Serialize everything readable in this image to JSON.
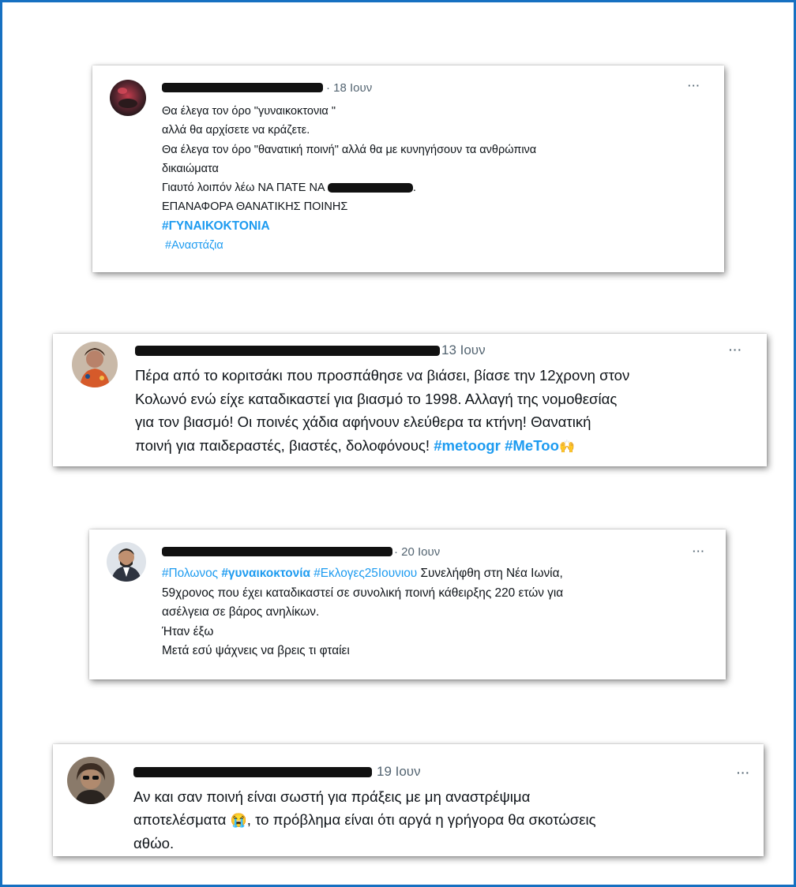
{
  "tweets": [
    {
      "time": "· 18 Ιουν",
      "more": "···",
      "lines": {
        "l1": "Θα έλεγα τον όρο \"γυναικοκτονια \"",
        "l2": "αλλά θα αρχίσετε να κράζετε.",
        "l3": "Θα έλεγα τον όρο \"θανατική ποινή\" αλλά θα με κυνηγήσουν τα ανθρώπινα",
        "l4": "δικαιώματα",
        "l5": "Γιαυτό λοιπόν λέω ΝΑ ΠΑΤΕ ΝΑ",
        "l5_end": ".",
        "l6": "ΕΠΑΝΑΦΟΡΑ ΘΑΝΑΤΙΚΗΣ ΠΟΙΝΗΣ",
        "tag1": "#ΓΥΝΑΙΚΟΚΤΟΝΙΑ",
        "tag2": "#Αναστάζια"
      }
    },
    {
      "time": "13 Ιουν",
      "more": "···",
      "lines": {
        "l1": "Πέρα από το κοριτσάκι που προσπάθησε να βιάσει, βίασε την 12χρονη στον",
        "l2": "Κολωνό ενώ είχε καταδικαστεί για βιασμό το 1998. Αλλαγή της νομοθεσίας",
        "l3": "για τον βιασμό! Οι ποινές χάδια αφήνουν ελεύθερα τα κτήνη! Θανατική",
        "l4": "ποινή για παιδεραστές, βιαστές, δολοφόνους!",
        "tag1": "#metoogr",
        "tag2": "#MeToo",
        "emoji": "🙌"
      }
    },
    {
      "time": "· 20 Ιουν",
      "more": "···",
      "lines": {
        "tag1": "#Πολωνος",
        "tag2": "#γυναικοκτονία",
        "tag3": "#Εκλογες25Ιουνιου",
        "l1_rest": "Συνελήφθη στη Νέα Ιωνία,",
        "l2": "59χρονος που έχει καταδικαστεί σε συνολική ποινή κάθειρξης 220 ετών για",
        "l3": "ασέλγεια σε βάρος ανηλίκων.",
        "l4": "Ήταν έξω",
        "l5": "Μετά εσύ ψάχνεις να βρεις τι φταίει"
      }
    },
    {
      "time": "19 Ιουν",
      "more": "···",
      "lines": {
        "l1": "Αν και σαν ποινή είναι σωστή για πράξεις με μη αναστρέψιμα",
        "l2a": "αποτελέσματα",
        "emoji": "😭",
        "l2b": ", το πρόβλημα είναι ότι αργά η γρήγορα θα σκοτώσεις",
        "l3": "αθώο."
      }
    }
  ]
}
